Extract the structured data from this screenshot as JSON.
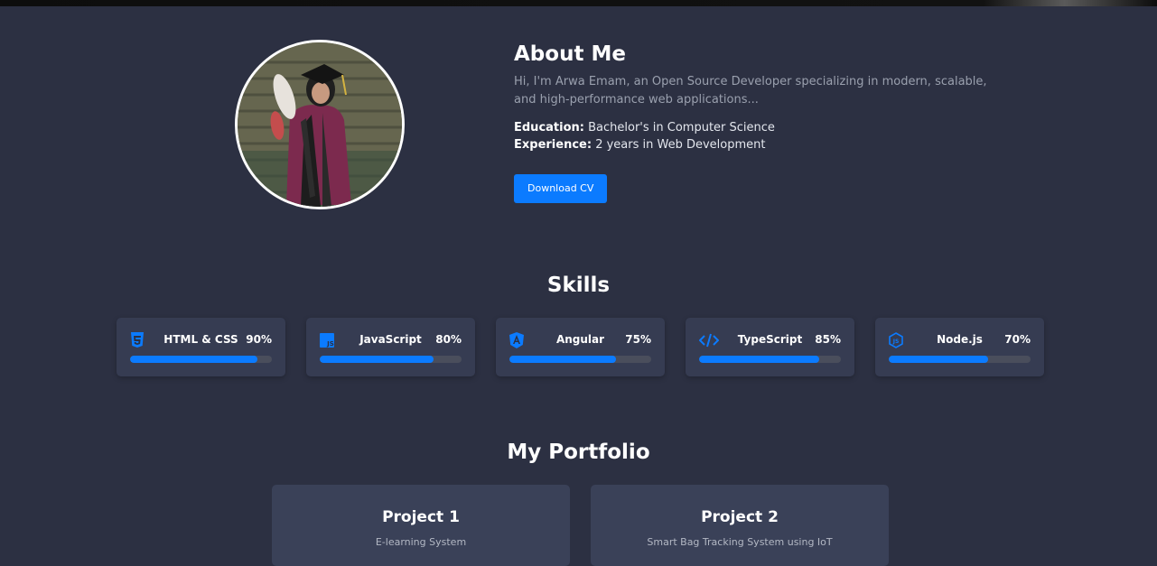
{
  "about": {
    "title": "About Me",
    "intro": "Hi, I'm Arwa Emam, an Open Source Developer specializing in modern, scalable, and high-performance web applications...",
    "education_label": "Education:",
    "education_value": " Bachelor's in Computer Science",
    "experience_label": "Experience:",
    "experience_value": " 2 years in Web Development",
    "download_label": "Download CV"
  },
  "skills": {
    "title": "Skills",
    "items": [
      {
        "name": "HTML & CSS",
        "percent_label": "90%",
        "level": 90,
        "icon": "html5-icon"
      },
      {
        "name": "JavaScript",
        "percent_label": "80%",
        "level": 80,
        "icon": "javascript-icon"
      },
      {
        "name": "Angular",
        "percent_label": "75%",
        "level": 75,
        "icon": "angular-icon"
      },
      {
        "name": "TypeScript",
        "percent_label": "85%",
        "level": 85,
        "icon": "code-icon"
      },
      {
        "name": "Node.js",
        "percent_label": "70%",
        "level": 70,
        "icon": "nodejs-icon"
      }
    ]
  },
  "portfolio": {
    "title": "My Portfolio",
    "projects": [
      {
        "name": "Project 1",
        "description": "E-learning System"
      },
      {
        "name": "Project 2",
        "description": "Smart Bag Tracking System using IoT"
      }
    ]
  },
  "colors": {
    "background": "#2c3042",
    "card": "#363c52",
    "accent": "#0b7bff",
    "track": "#4a4e5c"
  }
}
